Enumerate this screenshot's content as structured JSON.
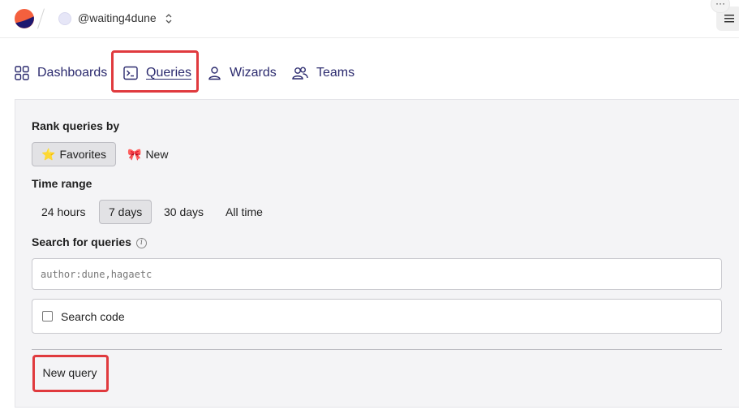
{
  "header": {
    "username": "@waiting4dune",
    "more_glyph": "···",
    "icons": [
      "dune-logo",
      "chevron-updown-icon",
      "more-icon",
      "hamburger-menu-icon"
    ]
  },
  "nav": {
    "tabs": [
      {
        "label": "Dashboards",
        "icon": "dashboards-grid-icon",
        "active": false
      },
      {
        "label": "Queries",
        "icon": "terminal-icon",
        "active": true
      },
      {
        "label": "Wizards",
        "icon": "person-icon",
        "active": false
      },
      {
        "label": "Teams",
        "icon": "people-icon",
        "active": false
      }
    ]
  },
  "filters": {
    "rank_label": "Rank queries by",
    "rank_options": [
      {
        "label": "Favorites",
        "emoji": "⭐",
        "selected": true
      },
      {
        "label": "New",
        "emoji": "🎀",
        "selected": false
      }
    ],
    "time_label": "Time range",
    "time_options": [
      {
        "label": "24 hours",
        "selected": false
      },
      {
        "label": "7 days",
        "selected": true
      },
      {
        "label": "30 days",
        "selected": false
      },
      {
        "label": "All time",
        "selected": false
      }
    ],
    "search_label": "Search for queries",
    "search_placeholder": "author:dune,hagaetc",
    "search_value": "",
    "search_code_label": "Search code",
    "search_code_checked": false,
    "new_query_label": "New query"
  },
  "colors": {
    "accent_nav": "#2b2a6e",
    "highlight": "#e03a3e",
    "logo_orange": "#f4603e",
    "logo_navy": "#1e1870"
  }
}
